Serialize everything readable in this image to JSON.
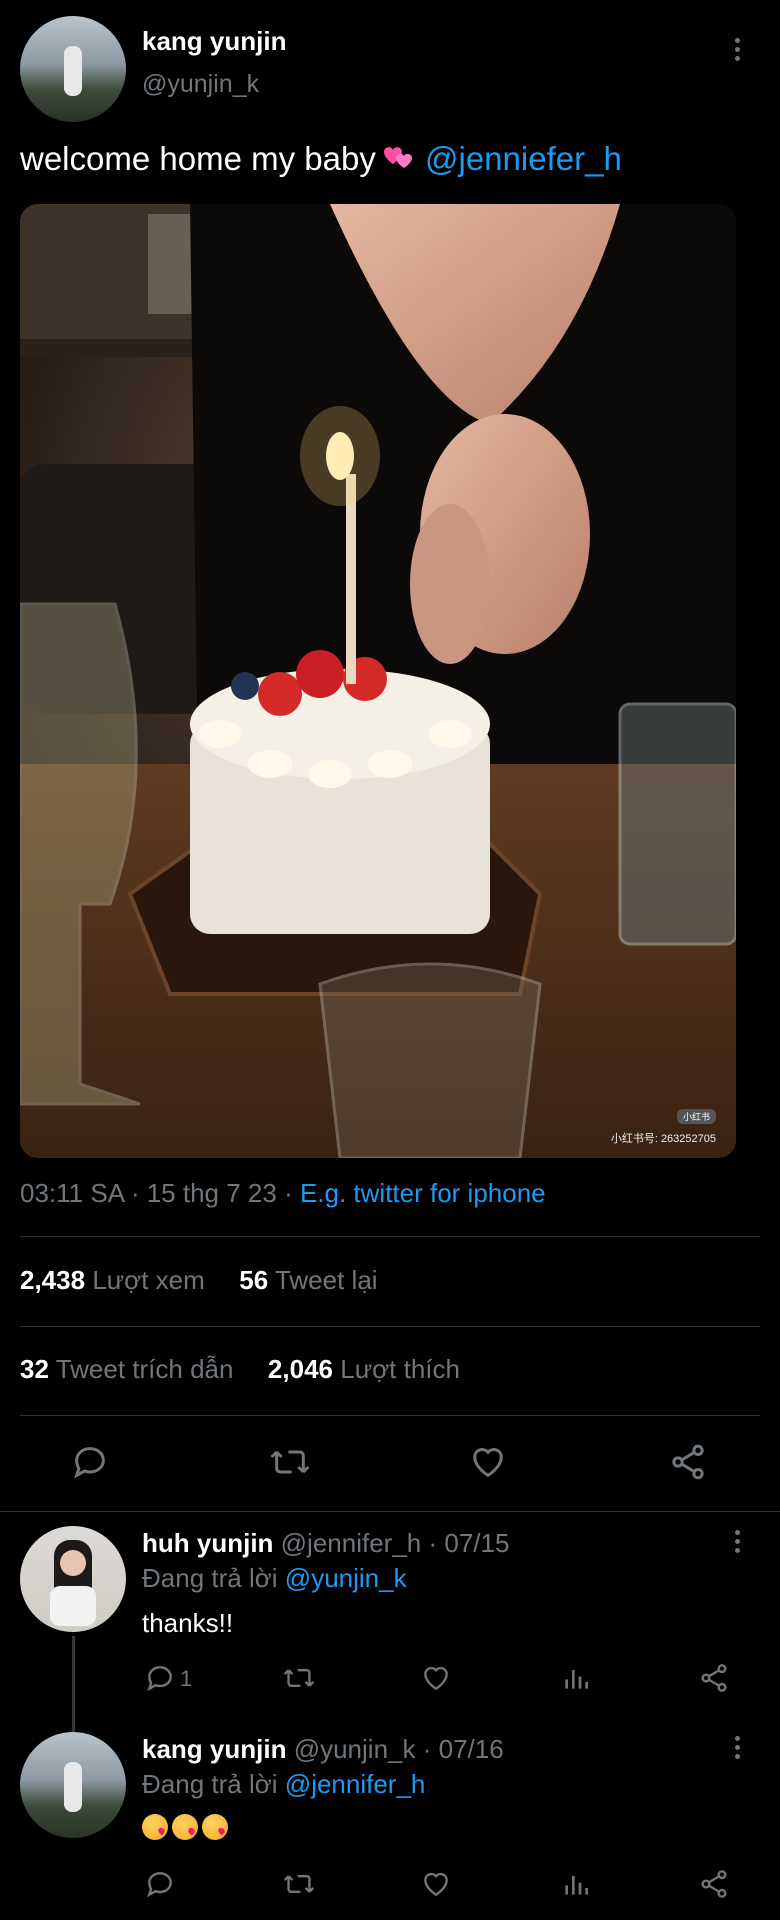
{
  "main_tweet": {
    "author_name": "kang yunjin",
    "author_handle": "@yunjin_k",
    "text": "welcome home my baby",
    "mention": "@jenniefer_h",
    "image_watermark": "小红书号: 263252705",
    "image_badge": "小红书",
    "time": "03:11 SA",
    "date": "15 thg 7 23",
    "source": "E.g. twitter for iphone",
    "stats": {
      "views_count": "2,438",
      "views_label": "Lượt xem",
      "retweets_count": "56",
      "retweets_label": "Tweet lại",
      "quotes_count": "32",
      "quotes_label": "Tweet trích dẫn",
      "likes_count": "2,046",
      "likes_label": "Lượt thích"
    }
  },
  "replies": [
    {
      "author_name": "huh yunjin",
      "author_handle": "@jennifer_h",
      "date": "07/15",
      "replying_label": "Đang trả lời",
      "replying_to": "@yunjin_k",
      "text": "thanks!!",
      "reply_count": "1"
    },
    {
      "author_name": "kang yunjin",
      "author_handle": "@yunjin_k",
      "date": "07/16",
      "replying_label": "Đang trả lời",
      "replying_to": "@jennifer_h",
      "text": ""
    }
  ],
  "icons": [
    "more-icon",
    "reply-icon",
    "retweet-icon",
    "like-icon",
    "share-icon",
    "views-icon"
  ],
  "colors": {
    "accent": "#1d9bf0",
    "muted": "#71767b",
    "background": "#000000"
  }
}
